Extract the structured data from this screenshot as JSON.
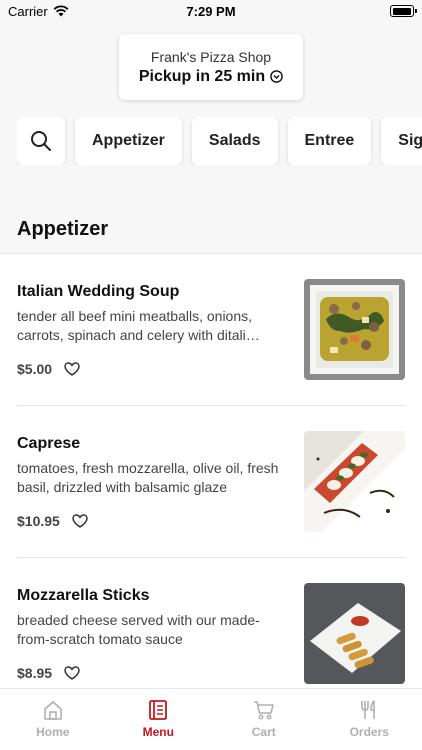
{
  "status_bar": {
    "carrier": "Carrier",
    "time": "7:29 PM",
    "battery_level": 0.95
  },
  "store": {
    "name": "Frank's Pizza Shop",
    "pickup_text": "Pickup in 25 min"
  },
  "categories": [
    "Appetizer",
    "Salads",
    "Entree",
    "Sig"
  ],
  "section": {
    "title": "Appetizer"
  },
  "items": [
    {
      "name": "Italian Wedding Soup",
      "description": "tender all beef mini meatballs, onions, carrots, spinach and celery with ditali…",
      "price": "$5.00"
    },
    {
      "name": "Caprese",
      "description": "tomatoes, fresh mozzarella, olive oil, fresh basil, drizzled with balsamic glaze",
      "price": "$10.95"
    },
    {
      "name": "Mozzarella Sticks",
      "description": "breaded cheese served with our made-from-scratch tomato sauce",
      "price": "$8.95"
    }
  ],
  "tabs": [
    {
      "label": "Home",
      "icon": "home-icon"
    },
    {
      "label": "Menu",
      "icon": "menu-book-icon"
    },
    {
      "label": "Cart",
      "icon": "cart-icon"
    },
    {
      "label": "Orders",
      "icon": "fork-knife-icon"
    }
  ],
  "colors": {
    "accent": "#c8161d",
    "inactive": "#b0b0b0"
  }
}
